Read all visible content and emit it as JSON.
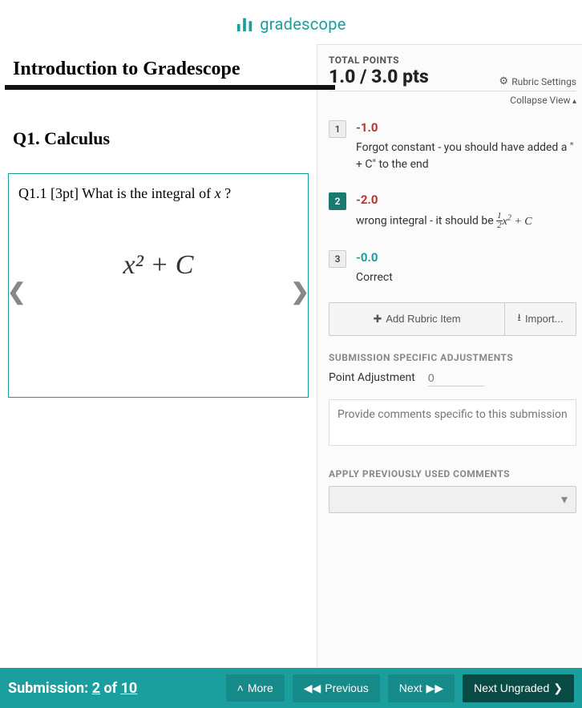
{
  "brand": "gradescope",
  "document": {
    "title": "Introduction to Gradescope",
    "question_heading": "Q1.  Calculus",
    "subquestion": "Q1.1  [3pt] What is the integral of ",
    "subquestion_var": "x",
    "subquestion_suffix": " ?",
    "student_answer": "x² + C"
  },
  "grading": {
    "total_points_label": "TOTAL POINTS",
    "score": "1.0 / 3.0 pts",
    "rubric_settings": "Rubric Settings",
    "collapse": "Collapse View",
    "items": [
      {
        "num": "1",
        "points": "-1.0",
        "desc": "Forgot constant - you should have added a \" + C\" to the end",
        "selected": false,
        "cls": "pts-neg"
      },
      {
        "num": "2",
        "points": "-2.0",
        "desc_prefix": "wrong integral - it should be ",
        "has_math": true,
        "selected": true,
        "cls": "pts-neg"
      },
      {
        "num": "3",
        "points": "-0.0",
        "desc": "Correct",
        "selected": false,
        "cls": "pts-zero"
      }
    ],
    "add_rubric": "Add Rubric Item",
    "import": "Import...",
    "adjustments_label": "SUBMISSION SPECIFIC ADJUSTMENTS",
    "point_adjustment_label": "Point Adjustment",
    "point_adjustment_placeholder": "0",
    "comments_placeholder": "Provide comments specific to this submission",
    "apply_prev_label": "APPLY PREVIOUSLY USED COMMENTS"
  },
  "footer": {
    "submission_prefix": "Submission: ",
    "current": "2",
    "of": " of ",
    "total": "10",
    "more": "More",
    "previous": "Previous",
    "next": "Next",
    "next_ungraded": "Next Ungraded"
  }
}
